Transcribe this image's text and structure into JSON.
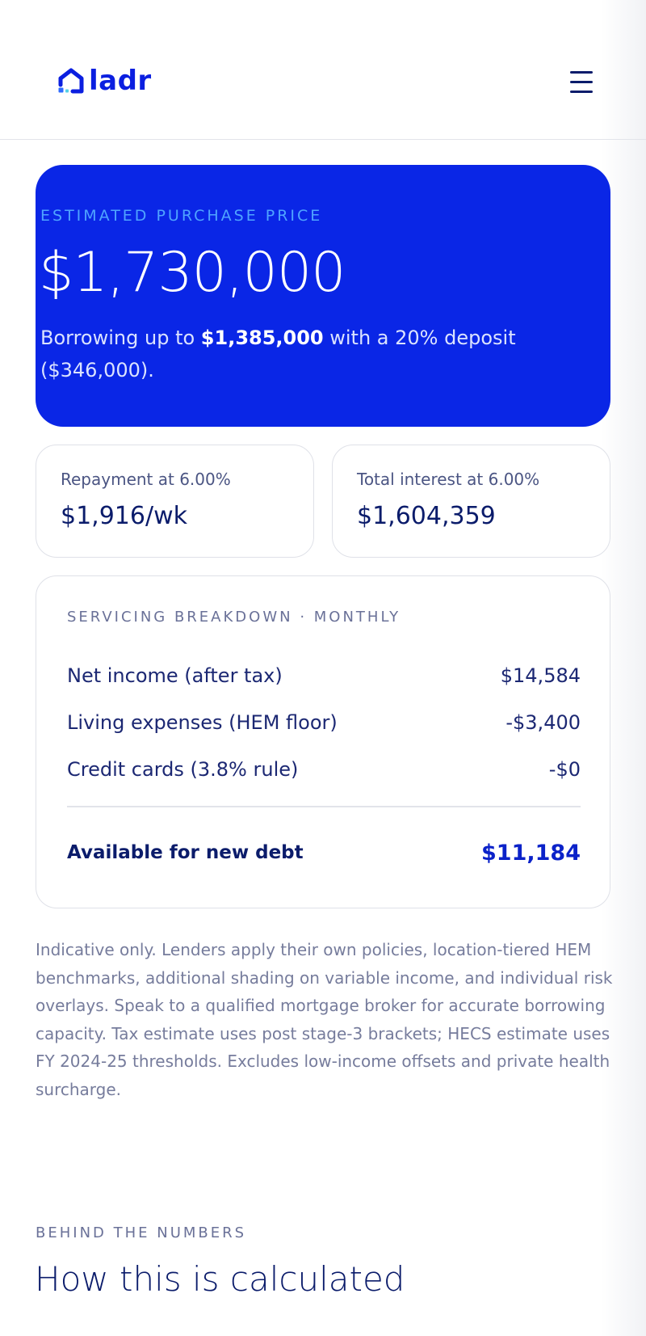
{
  "header": {
    "logo_text": "ladr",
    "brand_color": "#0b1fe0",
    "menu_icon": "hamburger-menu-icon"
  },
  "hero": {
    "eyebrow": "ESTIMATED PURCHASE PRICE",
    "price": "$1,730,000",
    "desc_prefix": "Borrowing up to ",
    "borrow_amount": "$1,385,000",
    "desc_middle": " with a 20% deposit",
    "desc_suffix": "($346,000).",
    "background_color": "#0a26e6"
  },
  "stats": [
    {
      "label": "Repayment at 6.00%",
      "value": "$1,916/wk"
    },
    {
      "label": "Total interest at 6.00%",
      "value": "$1,604,359"
    }
  ],
  "breakdown": {
    "eyebrow": "SERVICING BREAKDOWN · MONTHLY",
    "rows": [
      {
        "label": "Net income (after tax)",
        "value": "$14,584"
      },
      {
        "label": "Living expenses (HEM floor)",
        "value": "-$3,400"
      },
      {
        "label": "Credit cards (3.8% rule)",
        "value": "-$0"
      }
    ],
    "total_label": "Available for new debt",
    "total_value": "$11,184"
  },
  "disclaimer": "Indicative only. Lenders apply their own policies, location-tiered HEM benchmarks, additional shading on variable income, and individual risk overlays. Speak to a qualified mortgage broker for accurate borrowing capacity. Tax estimate uses post stage-3 brackets; HECS estimate uses FY 2024-25 thresholds. Excludes low-income offsets and private health surcharge.",
  "behind_numbers": {
    "eyebrow": "BEHIND THE NUMBERS",
    "title": "How this is calculated"
  }
}
